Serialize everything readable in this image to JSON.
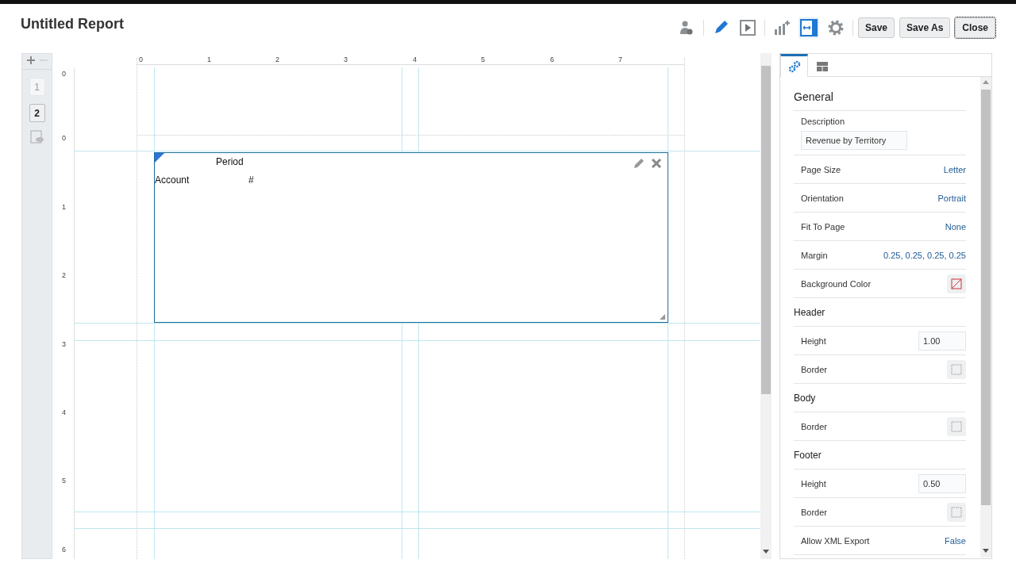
{
  "title": "Untitled Report",
  "toolbar": {
    "tools": [
      {
        "kind": "user",
        "selected": false
      },
      {
        "kind": "pencil",
        "selected": false
      },
      {
        "kind": "play",
        "selected": false
      },
      {
        "kind": "chart-add",
        "selected": false
      },
      {
        "kind": "fit-width",
        "selected": true
      },
      {
        "kind": "gear",
        "selected": false
      }
    ],
    "buttons": [
      {
        "label": "Save",
        "focused": false
      },
      {
        "label": "Save As",
        "focused": false
      },
      {
        "label": "Close",
        "focused": true
      }
    ]
  },
  "pages": [
    {
      "label": "1",
      "selected": false
    },
    {
      "label": "2",
      "selected": true
    }
  ],
  "ruler": {
    "x_labels": [
      "0",
      "1",
      "2",
      "3",
      "4",
      "5",
      "6",
      "7"
    ],
    "y_labels": [
      "0",
      "0",
      "1",
      "2",
      "3",
      "4",
      "5",
      "6"
    ]
  },
  "grid_object": {
    "column_header": "Period",
    "row_header": "Account",
    "cell": "#"
  },
  "panel": {
    "tabs": [
      {
        "kind": "gears",
        "selected": true
      },
      {
        "kind": "layout",
        "selected": false
      }
    ],
    "sections": [
      {
        "title": "General",
        "rows": [
          {
            "kind": "textbox",
            "label": "Description",
            "value": "Revenue by Territory"
          },
          {
            "kind": "link",
            "label": "Page Size",
            "value": "Letter"
          },
          {
            "kind": "link",
            "label": "Orientation",
            "value": "Portrait"
          },
          {
            "kind": "link",
            "label": "Fit To Page",
            "value": "None"
          },
          {
            "kind": "link",
            "label": "Margin",
            "value": "0.25, 0.25, 0.25, 0.25"
          },
          {
            "kind": "color",
            "label": "Background Color"
          }
        ]
      },
      {
        "title": "Header",
        "rows": [
          {
            "kind": "number",
            "label": "Height",
            "value": "1.00"
          },
          {
            "kind": "border",
            "label": "Border"
          }
        ]
      },
      {
        "title": "Body",
        "rows": [
          {
            "kind": "border",
            "label": "Border"
          }
        ]
      },
      {
        "title": "Footer",
        "rows": [
          {
            "kind": "number",
            "label": "Height",
            "value": "0.50"
          },
          {
            "kind": "border",
            "label": "Border"
          },
          {
            "kind": "link",
            "label": "Allow XML Export",
            "value": "False"
          }
        ]
      }
    ]
  }
}
